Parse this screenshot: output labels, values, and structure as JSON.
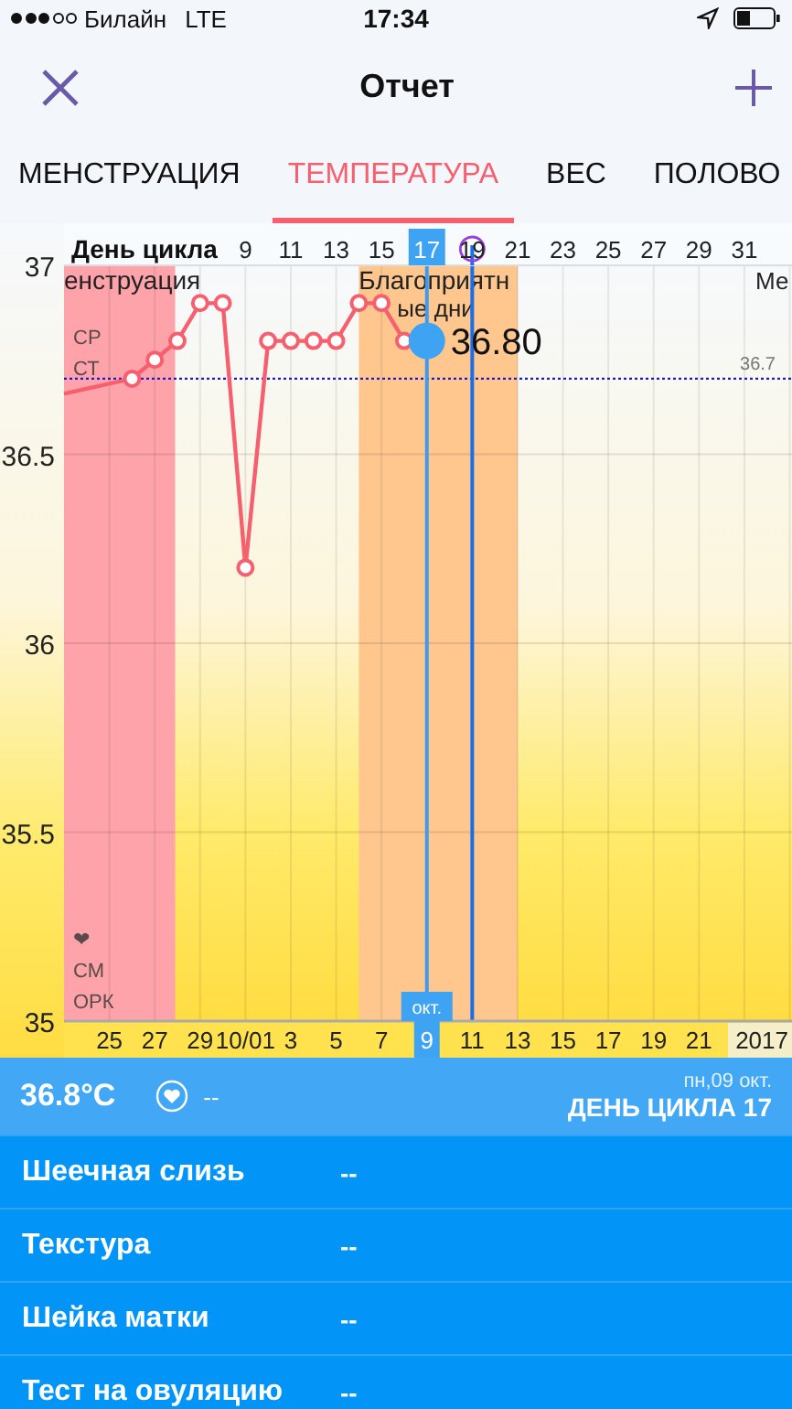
{
  "status_bar": {
    "carrier": "Билайн",
    "network": "LTE",
    "time": "17:34"
  },
  "nav": {
    "title": "Отчет"
  },
  "tabs": [
    {
      "label": "МЕНСТРУАЦИЯ",
      "selected": false
    },
    {
      "label": "ТЕМПЕРАТУРА",
      "selected": true
    },
    {
      "label": "ВЕС",
      "selected": false
    },
    {
      "label": "ПОЛОВО",
      "selected": false
    }
  ],
  "chart": {
    "cycle_label": "День цикла",
    "cycle_ticks": [
      {
        "label": "9",
        "selected": false,
        "marked": false
      },
      {
        "label": "11",
        "selected": false,
        "marked": false
      },
      {
        "label": "13",
        "selected": false,
        "marked": false
      },
      {
        "label": "15",
        "selected": false,
        "marked": false
      },
      {
        "label": "17",
        "selected": true,
        "marked": false
      },
      {
        "label": "19",
        "selected": false,
        "marked": true
      },
      {
        "label": "21",
        "selected": false,
        "marked": false
      },
      {
        "label": "23",
        "selected": false,
        "marked": false
      },
      {
        "label": "25",
        "selected": false,
        "marked": false
      },
      {
        "label": "27",
        "selected": false,
        "marked": false
      },
      {
        "label": "29",
        "selected": false,
        "marked": false
      },
      {
        "label": "31",
        "selected": false,
        "marked": false
      }
    ],
    "date_ticks": [
      {
        "label": "25",
        "selected": false
      },
      {
        "label": "27",
        "selected": false
      },
      {
        "label": "29",
        "selected": false
      },
      {
        "label": "10/01",
        "selected": false
      },
      {
        "label": "3",
        "selected": false
      },
      {
        "label": "5",
        "selected": false
      },
      {
        "label": "7",
        "selected": false
      },
      {
        "label": "9",
        "selected": true
      },
      {
        "label": "11",
        "selected": false
      },
      {
        "label": "13",
        "selected": false
      },
      {
        "label": "15",
        "selected": false
      },
      {
        "label": "17",
        "selected": false
      },
      {
        "label": "19",
        "selected": false
      },
      {
        "label": "21",
        "selected": false
      }
    ],
    "month_badge": "окт.",
    "year_label": "2017",
    "band_labels": [
      {
        "lines": [
          "енструация"
        ]
      },
      {
        "lines": [
          "Благоприятн",
          "ые дни"
        ]
      }
    ],
    "edge_label": "Ме",
    "top_notes": [
      "СР",
      "СТ"
    ],
    "bottom_notes": [
      "❤",
      "СМ",
      "ОРК"
    ],
    "chart_data": {
      "type": "line",
      "ylim": [
        35,
        37
      ],
      "xlim": [
        1,
        33.1
      ],
      "grid": true,
      "yticks": [
        35,
        35.5,
        36,
        36.5,
        37
      ],
      "xticks": [
        9,
        11,
        13,
        15,
        17,
        19,
        21,
        23,
        25,
        27,
        29,
        31
      ],
      "x": [
        1,
        4,
        5,
        6,
        7,
        8,
        9,
        10,
        11,
        12,
        13,
        14,
        15,
        16,
        17
      ],
      "series": [
        {
          "color": "#f65f6e",
          "marker": "o",
          "values": [
            36.66,
            36.7,
            36.75,
            36.8,
            36.9,
            36.9,
            36.2,
            36.8,
            36.8,
            36.8,
            36.8,
            36.9,
            36.9,
            36.8,
            36.8
          ]
        }
      ],
      "bands": [
        {
          "axis": "x",
          "from": 1,
          "to": 5.9,
          "color": "#ffa3aa"
        },
        {
          "axis": "x",
          "from": 14,
          "to": 21,
          "color": "#ffc78e"
        }
      ],
      "ref_lines": [
        {
          "axis": "y",
          "value": 36.7,
          "label": "36.7",
          "color": "#1a1ad0"
        },
        {
          "axis": "x",
          "value": 17,
          "color": "#3d9cf0"
        },
        {
          "axis": "x",
          "value": 19,
          "color": "#1a6fe8"
        }
      ],
      "annotations": [
        {
          "x": 17,
          "y": 36.8,
          "text": "36.80"
        }
      ]
    }
  },
  "summary": {
    "temperature": "36.8°C",
    "mood": "--",
    "date": "пн,09 окт.",
    "cycle_day": "ДЕНЬ ЦИКЛА 17"
  },
  "rows": [
    {
      "label": "Шеечная слизь",
      "value": "--"
    },
    {
      "label": "Текстура",
      "value": "--"
    },
    {
      "label": "Шейка матки",
      "value": "--"
    },
    {
      "label": "Тест на овуляцию",
      "value": "--"
    }
  ]
}
